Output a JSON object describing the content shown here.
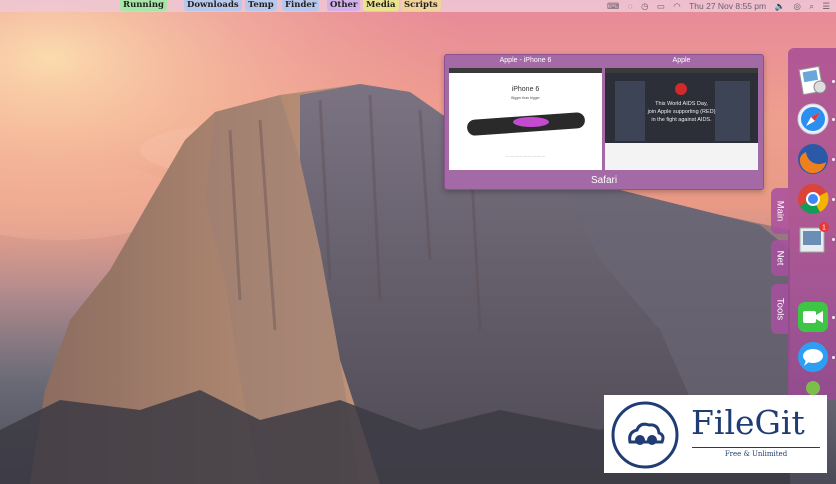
{
  "menubar": {
    "tabs": [
      {
        "label": "Running",
        "color": "#a6e6a6"
      },
      {
        "label": "Downloads",
        "color": "#b8c7ec"
      },
      {
        "label": "Temp",
        "color": "#b8c7ec"
      },
      {
        "label": "Finder",
        "color": "#b8c7ec"
      },
      {
        "label": "Other",
        "color": "#d3b0ea"
      },
      {
        "label": "Media",
        "color": "#ebe38e"
      },
      {
        "label": "Scripts",
        "color": "#f2d39b"
      }
    ],
    "clock": "Thu 27 Nov  8:55 pm"
  },
  "preview": {
    "thumbs": [
      {
        "title": "Apple - iPhone 6",
        "heading": "iPhone 6",
        "subheading": "Bigger than bigger"
      },
      {
        "title": "Apple",
        "heading": "This World AIDS Day,",
        "line2": "join Apple supporting (RED)",
        "line3": "in the fight against AIDS."
      }
    ],
    "app_label": "Safari"
  },
  "dock": {
    "tabs": [
      "Main",
      "Net",
      "Tools"
    ],
    "icons": [
      "preview-icon",
      "safari-icon",
      "firefox-icon",
      "chrome-icon",
      "mail-icon",
      "facetime-icon",
      "messages-icon",
      "game-center-icon"
    ],
    "mail_badge": "1"
  },
  "watermark": {
    "name": "FileGit",
    "tagline": "Free & Unlimited"
  }
}
